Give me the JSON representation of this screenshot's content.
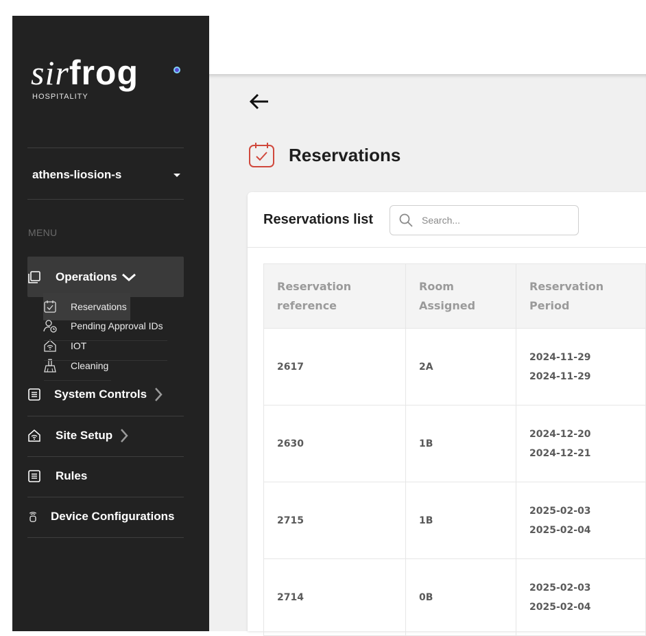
{
  "brand": {
    "word_italic": "sir",
    "word_bold": "frog",
    "subtitle": "HOSPITALITY"
  },
  "site_selector": {
    "value": "athens-liosion-s"
  },
  "menu": {
    "heading": "MENU",
    "operations": {
      "label": "Operations",
      "items": [
        {
          "label": "Reservations",
          "icon": "calendar-check-icon",
          "active": true
        },
        {
          "label": "Pending Approval IDs",
          "icon": "user-clock-icon"
        },
        {
          "label": "IOT",
          "icon": "home-wifi-icon"
        },
        {
          "label": "Cleaning",
          "icon": "broom-icon"
        }
      ]
    },
    "system_controls": {
      "label": "System Controls"
    },
    "site_setup": {
      "label": "Site Setup"
    },
    "rules": {
      "label": "Rules"
    },
    "device_configurations": {
      "label": "Device Configurations"
    }
  },
  "page": {
    "title": "Reservations"
  },
  "list": {
    "title": "Reservations list",
    "search_placeholder": "Search...",
    "columns": [
      {
        "line1": "Reservation",
        "line2": "reference"
      },
      {
        "line1": "Room",
        "line2": "Assigned"
      },
      {
        "line1": "Reservation",
        "line2": "Period"
      }
    ],
    "rows": [
      {
        "reference": "2617",
        "room": "2A",
        "start": "2024-11-29",
        "end": "2024-11-29"
      },
      {
        "reference": "2630",
        "room": "1B",
        "start": "2024-12-20",
        "end": "2024-12-21"
      },
      {
        "reference": "2715",
        "room": "1B",
        "start": "2025-02-03",
        "end": "2025-02-04"
      },
      {
        "reference": "2714",
        "room": "0B",
        "start": "2025-02-03",
        "end": "2025-02-04"
      }
    ]
  },
  "colors": {
    "sidebar_bg": "#222222",
    "accent": "#c0392b",
    "main_bg": "#f0f0f0"
  }
}
